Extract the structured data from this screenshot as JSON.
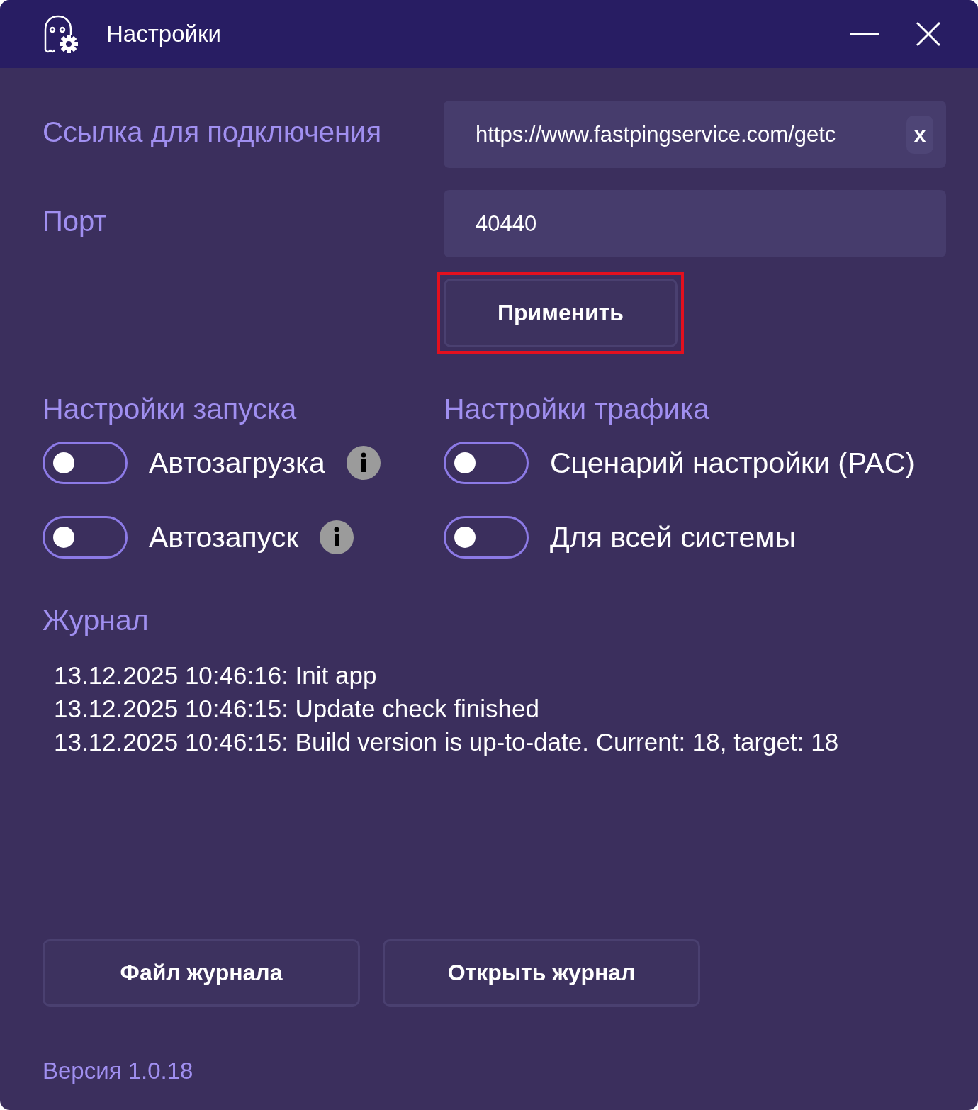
{
  "window": {
    "title": "Настройки",
    "controls": [
      {
        "kind": "minimize"
      },
      {
        "kind": "close"
      }
    ]
  },
  "connection": {
    "url_label": "Ссылка для подключения",
    "url_value": "https://www.fastpingservice.com/getc",
    "clear_button": "x",
    "port_label": "Порт",
    "port_value": "40440",
    "apply_button": {
      "label": "Применить",
      "highlighted": true
    }
  },
  "startup": {
    "heading": "Настройки запуска",
    "options": [
      {
        "label": "Автозагрузка",
        "on": false,
        "info": true
      },
      {
        "label": "Автозапуск",
        "on": false,
        "info": true
      }
    ]
  },
  "traffic": {
    "heading": "Настройки трафика",
    "options": [
      {
        "label": "Сценарий настройки (PAC)",
        "on": false,
        "info": false
      },
      {
        "label": "Для всей системы",
        "on": false,
        "info": false
      }
    ]
  },
  "log": {
    "heading": "Журнал",
    "lines": [
      "13.12.2025 10:46:16: Init app",
      "13.12.2025 10:46:15: Update check finished",
      "13.12.2025 10:46:15: Build version is up-to-date. Current: 18, target: 18"
    ]
  },
  "buttons": [
    "Файл журнала",
    "Открыть журнал"
  ],
  "version": "Версия 1.0.18"
}
